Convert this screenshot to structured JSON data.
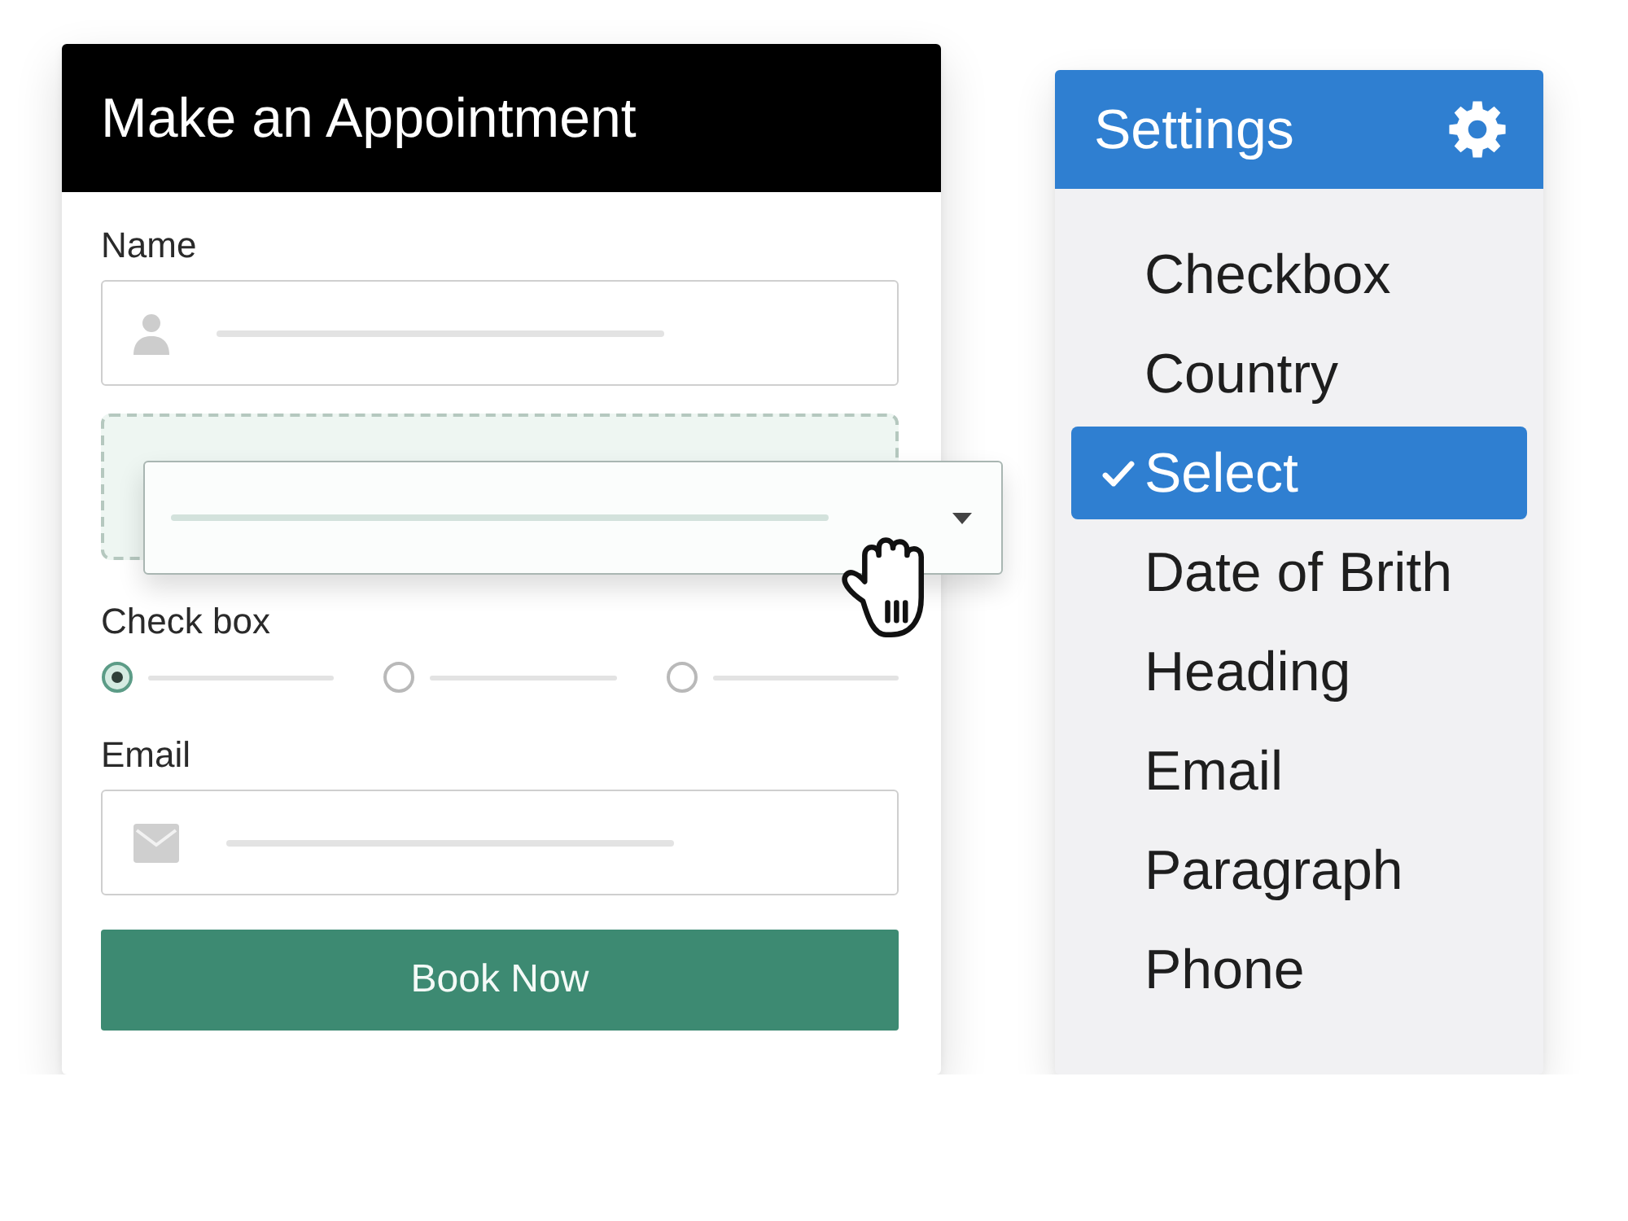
{
  "appointment_form": {
    "title": "Make an Appointment",
    "fields": [
      {
        "kind": "text",
        "label": "Name"
      },
      {
        "kind": "dropzone"
      },
      {
        "kind": "radio",
        "label": "Check box",
        "options": [
          {
            "selected": true
          },
          {
            "selected": false
          },
          {
            "selected": false
          }
        ]
      },
      {
        "kind": "email",
        "label": "Email"
      }
    ],
    "submit_button": "Book Now"
  },
  "settings_panel": {
    "title": "Settings",
    "items": [
      {
        "label": "Checkbox",
        "selected": false
      },
      {
        "label": "Country",
        "selected": false
      },
      {
        "label": "Select",
        "selected": true
      },
      {
        "label": "Date of Brith",
        "selected": false
      },
      {
        "label": "Heading",
        "selected": false
      },
      {
        "label": "Email",
        "selected": false
      },
      {
        "label": "Paragraph",
        "selected": false
      },
      {
        "label": "Phone",
        "selected": false
      }
    ]
  }
}
